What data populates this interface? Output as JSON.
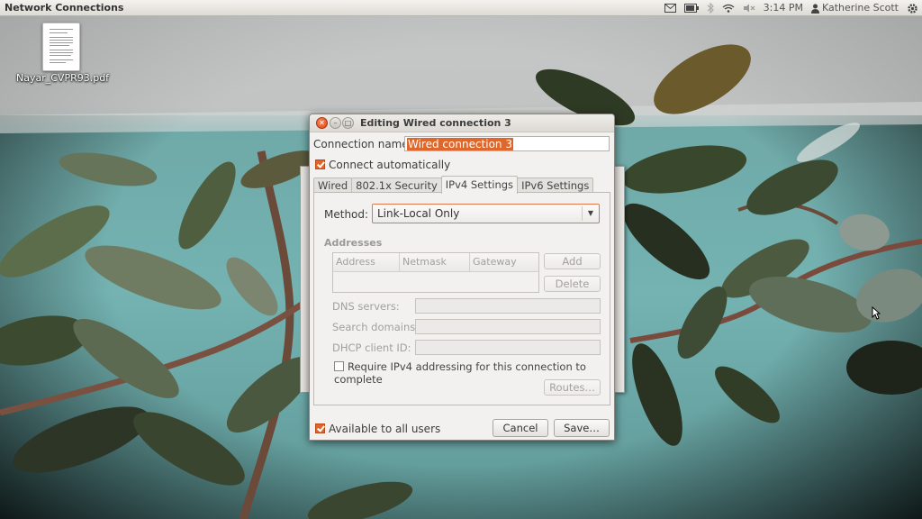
{
  "top_panel": {
    "title": "Network Connections",
    "clock": "3:14 PM",
    "user": "Katherine Scott",
    "indicators": [
      "mail-icon",
      "battery-icon",
      "bluetooth-icon",
      "wifi-icon",
      "volume-muted-icon",
      "gear-icon"
    ]
  },
  "desktop": {
    "file_label": "Nayar_CVPR93.pdf"
  },
  "dialog": {
    "title": "Editing Wired connection 3",
    "connection_name_label": "Connection name:",
    "connection_name_value": "Wired connection 3",
    "connect_auto_label": "Connect automatically",
    "connect_auto_checked": true,
    "tabs": [
      {
        "label": "Wired",
        "active": false
      },
      {
        "label": "802.1x Security",
        "active": false
      },
      {
        "label": "IPv4 Settings",
        "active": true
      },
      {
        "label": "IPv6 Settings",
        "active": false
      }
    ],
    "method_label": "Method:",
    "method_value": "Link-Local Only",
    "addresses_heading": "Addresses",
    "address_columns": [
      "Address",
      "Netmask",
      "Gateway"
    ],
    "add_button": "Add",
    "delete_button": "Delete",
    "dns_label": "DNS servers:",
    "search_domains_label": "Search domains:",
    "dhcp_client_label": "DHCP client ID:",
    "require_ipv4_label": "Require IPv4 addressing for this connection to complete",
    "require_ipv4_checked": false,
    "routes_button": "Routes…",
    "available_all_label": "Available to all users",
    "available_all_checked": true,
    "cancel_button": "Cancel",
    "save_button": "Save…"
  },
  "colors": {
    "accent": "#e1652a",
    "close_button": "#dd4814",
    "panel_bg": "#dedbd5",
    "dialog_bg": "#f2f1f0"
  }
}
